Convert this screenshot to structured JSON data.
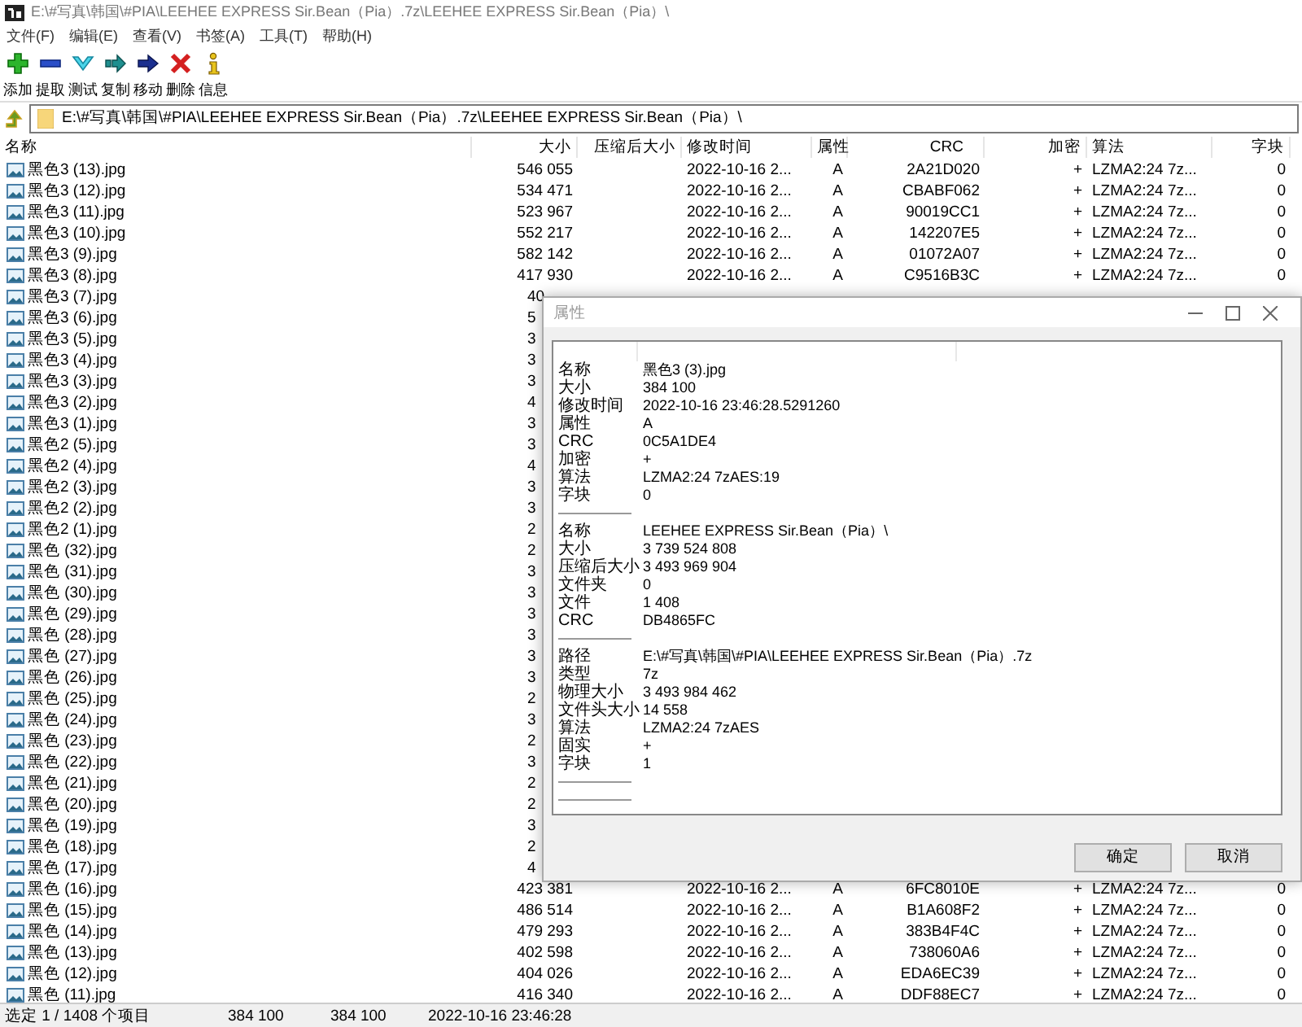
{
  "window": {
    "title": "E:\\#写真\\韩国\\#PIA\\LEEHEE EXPRESS Sir.Bean（Pia）.7z\\LEEHEE EXPRESS Sir.Bean（Pia）\\"
  },
  "menu": [
    "文件(F)",
    "编辑(E)",
    "查看(V)",
    "书签(A)",
    "工具(T)",
    "帮助(H)"
  ],
  "toolbar": [
    {
      "kind": "add",
      "label": "添加"
    },
    {
      "kind": "extract",
      "label": "提取"
    },
    {
      "kind": "test",
      "label": "测试"
    },
    {
      "kind": "copy",
      "label": "复制"
    },
    {
      "kind": "move",
      "label": "移动"
    },
    {
      "kind": "delete",
      "label": "删除"
    },
    {
      "kind": "info",
      "label": "信息"
    }
  ],
  "address": "E:\\#写真\\韩国\\#PIA\\LEEHEE EXPRESS Sir.Bean（Pia）.7z\\LEEHEE EXPRESS Sir.Bean（Pia）\\",
  "table": {
    "columns": [
      "名称",
      "大小",
      "压缩后大小",
      "修改时间",
      "属性",
      "CRC",
      "加密",
      "算法",
      "字块"
    ],
    "rows": [
      {
        "name": "黑色3 (13).jpg",
        "size": "546 055",
        "modified": "2022-10-16 2...",
        "attributes": "A",
        "crc": "2A21D020",
        "encrypted": "+",
        "method": "LZMA2:24 7z...",
        "block": "0"
      },
      {
        "name": "黑色3 (12).jpg",
        "size": "534 471",
        "modified": "2022-10-16 2...",
        "attributes": "A",
        "crc": "CBABF062",
        "encrypted": "+",
        "method": "LZMA2:24 7z...",
        "block": "0"
      },
      {
        "name": "黑色3 (11).jpg",
        "size": "523 967",
        "modified": "2022-10-16 2...",
        "attributes": "A",
        "crc": "90019CC1",
        "encrypted": "+",
        "method": "LZMA2:24 7z...",
        "block": "0"
      },
      {
        "name": "黑色3 (10).jpg",
        "size": "552 217",
        "modified": "2022-10-16 2...",
        "attributes": "A",
        "crc": "142207E5",
        "encrypted": "+",
        "method": "LZMA2:24 7z...",
        "block": "0"
      },
      {
        "name": "黑色3 (9).jpg",
        "size": "582 142",
        "modified": "2022-10-16 2...",
        "attributes": "A",
        "crc": "01072A07",
        "encrypted": "+",
        "method": "LZMA2:24 7z...",
        "block": "0"
      },
      {
        "name": "黑色3 (8).jpg",
        "size": "417 930",
        "modified": "2022-10-16 2...",
        "attributes": "A",
        "crc": "C9516B3C",
        "encrypted": "+",
        "method": "LZMA2:24 7z...",
        "block": "0"
      },
      {
        "name": "黑色3 (7).jpg",
        "size": "40"
      },
      {
        "name": "黑色3 (6).jpg",
        "size": "5"
      },
      {
        "name": "黑色3 (5).jpg",
        "size": "3"
      },
      {
        "name": "黑色3 (4).jpg",
        "size": "3"
      },
      {
        "name": "黑色3 (3).jpg",
        "size": "3"
      },
      {
        "name": "黑色3 (2).jpg",
        "size": "4"
      },
      {
        "name": "黑色3 (1).jpg",
        "size": "3"
      },
      {
        "name": "黑色2 (5).jpg",
        "size": "3"
      },
      {
        "name": "黑色2 (4).jpg",
        "size": "4"
      },
      {
        "name": "黑色2 (3).jpg",
        "size": "3"
      },
      {
        "name": "黑色2 (2).jpg",
        "size": "3"
      },
      {
        "name": "黑色2 (1).jpg",
        "size": "2"
      },
      {
        "name": "黑色 (32).jpg",
        "size": "2"
      },
      {
        "name": "黑色 (31).jpg",
        "size": "3"
      },
      {
        "name": "黑色 (30).jpg",
        "size": "3"
      },
      {
        "name": "黑色 (29).jpg",
        "size": "3"
      },
      {
        "name": "黑色 (28).jpg",
        "size": "3"
      },
      {
        "name": "黑色 (27).jpg",
        "size": "3"
      },
      {
        "name": "黑色 (26).jpg",
        "size": "3"
      },
      {
        "name": "黑色 (25).jpg",
        "size": "2"
      },
      {
        "name": "黑色 (24).jpg",
        "size": "3"
      },
      {
        "name": "黑色 (23).jpg",
        "size": "2"
      },
      {
        "name": "黑色 (22).jpg",
        "size": "3"
      },
      {
        "name": "黑色 (21).jpg",
        "size": "2"
      },
      {
        "name": "黑色 (20).jpg",
        "size": "2"
      },
      {
        "name": "黑色 (19).jpg",
        "size": "3"
      },
      {
        "name": "黑色 (18).jpg",
        "size": "2"
      },
      {
        "name": "黑色 (17).jpg",
        "size": "4"
      },
      {
        "name": "黑色 (16).jpg",
        "size": "423 381",
        "modified": "2022-10-16 2...",
        "attributes": "A",
        "crc": "6FC8010E",
        "encrypted": "+",
        "method": "LZMA2:24 7z...",
        "block": "0"
      },
      {
        "name": "黑色 (15).jpg",
        "size": "486 514",
        "modified": "2022-10-16 2...",
        "attributes": "A",
        "crc": "B1A608F2",
        "encrypted": "+",
        "method": "LZMA2:24 7z...",
        "block": "0"
      },
      {
        "name": "黑色 (14).jpg",
        "size": "479 293",
        "modified": "2022-10-16 2...",
        "attributes": "A",
        "crc": "383B4F4C",
        "encrypted": "+",
        "method": "LZMA2:24 7z...",
        "block": "0"
      },
      {
        "name": "黑色 (13).jpg",
        "size": "402 598",
        "modified": "2022-10-16 2...",
        "attributes": "A",
        "crc": "738060A6",
        "encrypted": "+",
        "method": "LZMA2:24 7z...",
        "block": "0"
      },
      {
        "name": "黑色 (12).jpg",
        "size": "404 026",
        "modified": "2022-10-16 2...",
        "attributes": "A",
        "crc": "EDA6EC39",
        "encrypted": "+",
        "method": "LZMA2:24 7z...",
        "block": "0"
      },
      {
        "name": "黑色 (11).jpg",
        "size": "416 340",
        "modified": "2022-10-16 2...",
        "attributes": "A",
        "crc": "DDF88EC7",
        "encrypted": "+",
        "method": "LZMA2:24 7z...",
        "block": "0"
      }
    ]
  },
  "status_bar": [
    "选定 1 / 1408 个项目",
    "384 100",
    "384 100",
    "2022-10-16 23:46:28"
  ],
  "dialog": {
    "title": "属性",
    "sections": [
      {
        "items": [
          {
            "label": "名称",
            "value": "黑色3 (3).jpg"
          },
          {
            "label": "大小",
            "value": "384 100"
          },
          {
            "label": "修改时间",
            "value": "2022-10-16 23:46:28.5291260"
          },
          {
            "label": "属性",
            "value": "A"
          },
          {
            "label": "CRC",
            "value": "0C5A1DE4"
          },
          {
            "label": "加密",
            "value": "+"
          },
          {
            "label": "算法",
            "value": "LZMA2:24 7zAES:19"
          },
          {
            "label": "字块",
            "value": "0"
          }
        ]
      },
      {
        "items": [
          {
            "label": "名称",
            "value": "LEEHEE EXPRESS Sir.Bean（Pia）\\"
          },
          {
            "label": "大小",
            "value": "3 739 524 808"
          },
          {
            "label": "压缩后大小",
            "value": "3 493 969 904"
          },
          {
            "label": "文件夹",
            "value": "0"
          },
          {
            "label": "文件",
            "value": "1 408"
          },
          {
            "label": "CRC",
            "value": "DB4865FC"
          }
        ]
      },
      {
        "items": [
          {
            "label": "路径",
            "value": "E:\\#写真\\韩国\\#PIA\\LEEHEE EXPRESS Sir.Bean（Pia）.7z"
          },
          {
            "label": "类型",
            "value": "7z"
          },
          {
            "label": "物理大小",
            "value": "3 493 984 462"
          },
          {
            "label": "文件头大小",
            "value": "14 558"
          },
          {
            "label": "算法",
            "value": "LZMA2:24 7zAES"
          },
          {
            "label": "固实",
            "value": "+"
          },
          {
            "label": "字块",
            "value": "1"
          }
        ]
      }
    ],
    "buttons": [
      "确定",
      "取消"
    ]
  }
}
